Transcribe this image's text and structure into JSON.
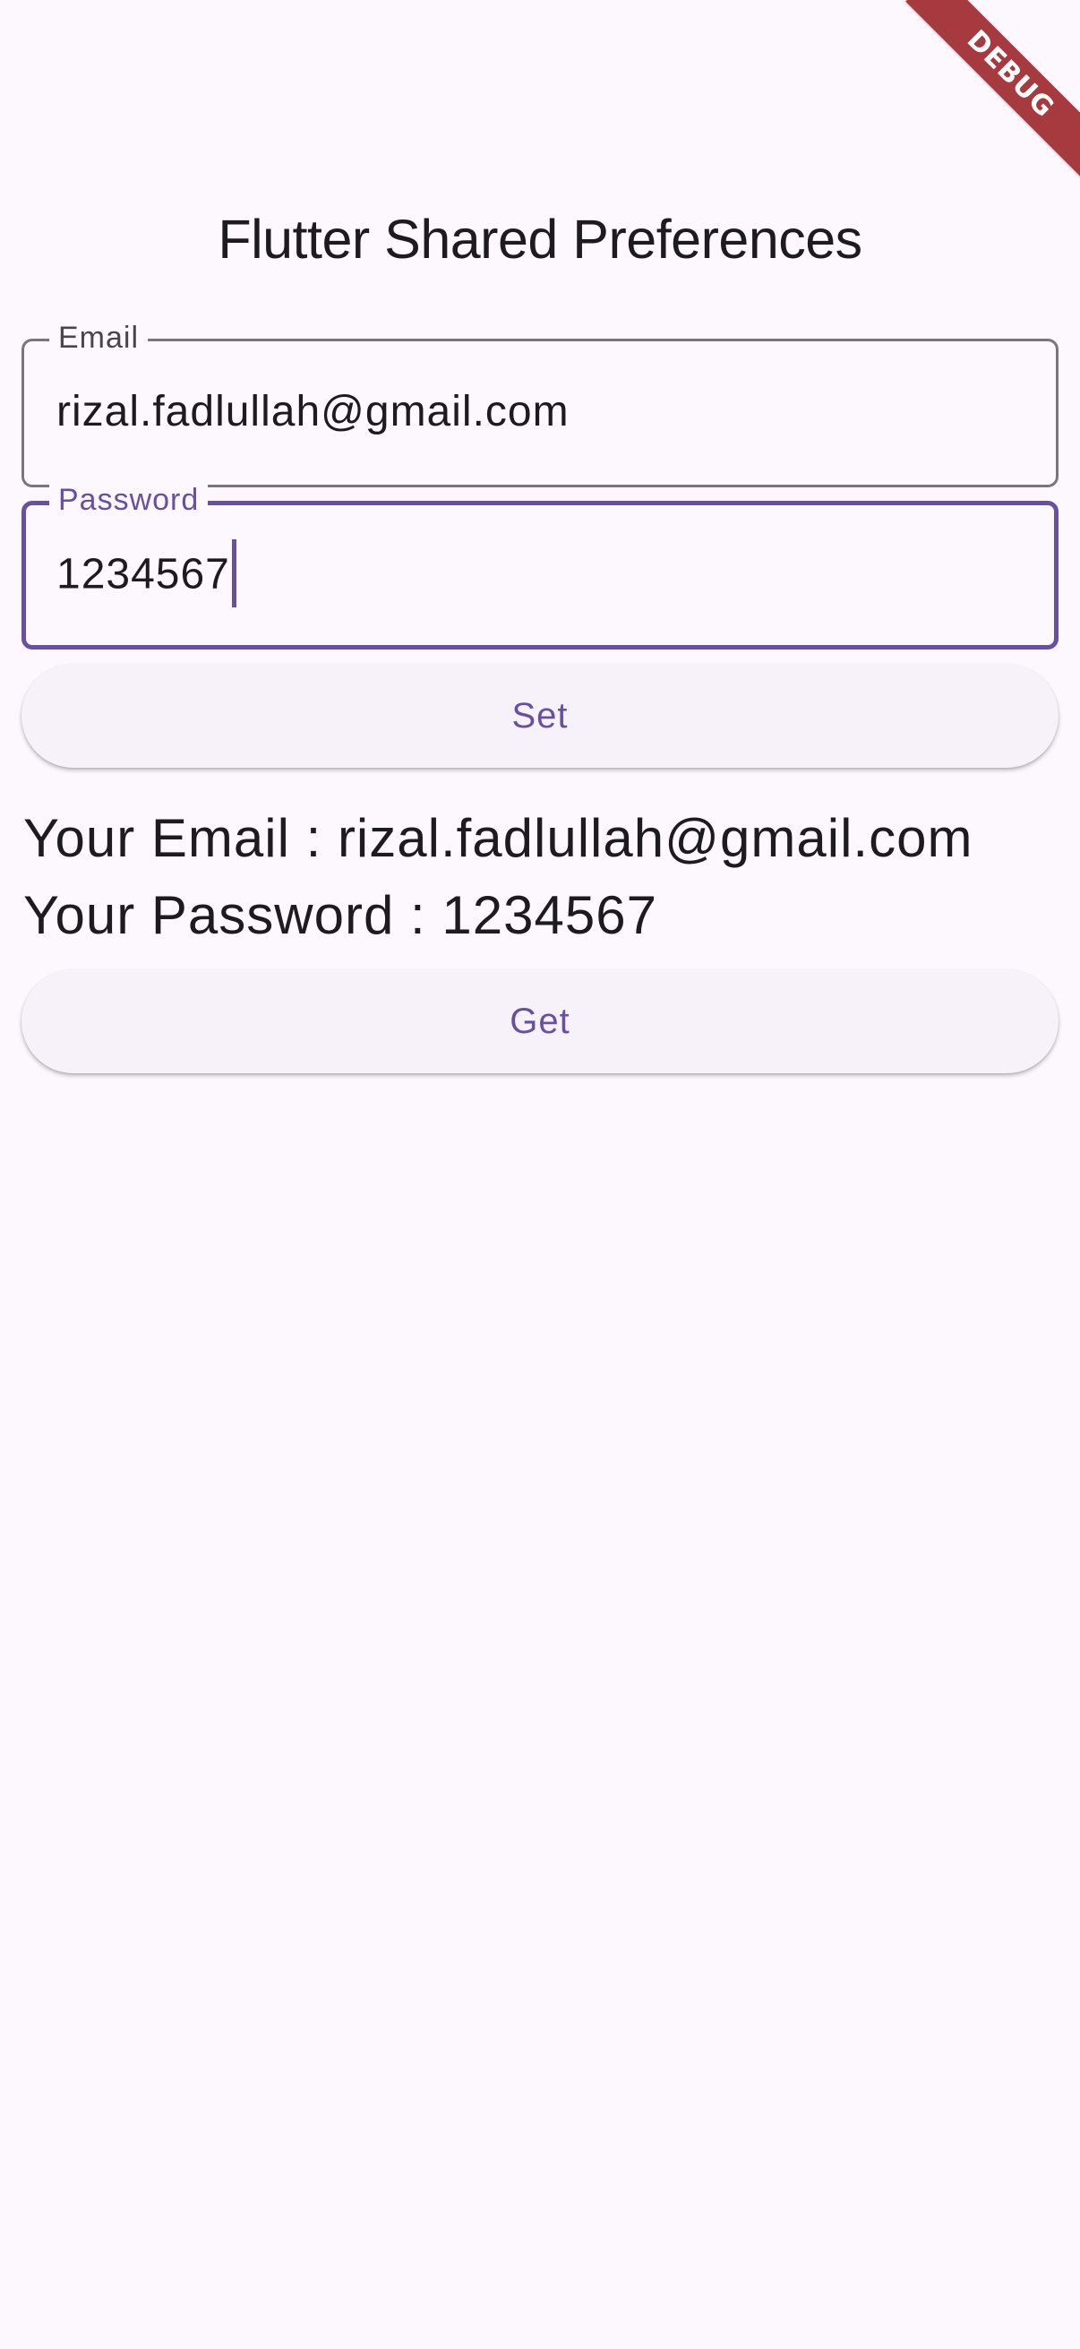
{
  "app_bar": {
    "title": "Flutter Shared Preferences"
  },
  "debug_banner": {
    "label": "DEBUG"
  },
  "form": {
    "email_field": {
      "label": "Email",
      "value": "rizal.fadlullah@gmail.com"
    },
    "password_field": {
      "label": "Password",
      "value": "1234567"
    },
    "set_button": "Set",
    "get_button": "Get"
  },
  "results": {
    "email_line": "Your Email : rizal.fadlullah@gmail.com",
    "password_line": "Your Password : 1234567"
  },
  "colors": {
    "background": "#fdf7fe",
    "primary": "#6750a4",
    "outline": "#79747e",
    "button_surface": "#f7f2fa",
    "debug_banner": "#a63a3f"
  }
}
